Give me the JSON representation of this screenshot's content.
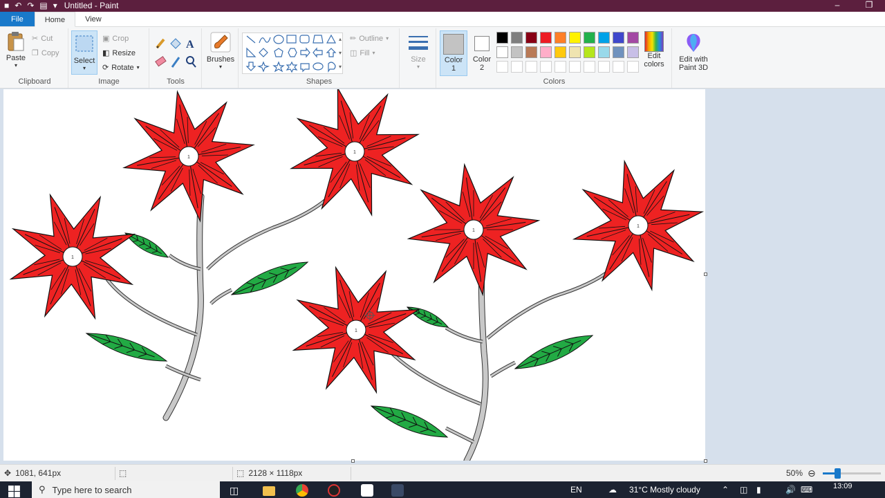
{
  "window": {
    "title": "Untitled - Paint",
    "minimize_glyph": "–",
    "restore_glyph": "❐"
  },
  "quick_access": {
    "undo_icon": "undo-icon",
    "redo_icon": "redo-icon",
    "save_icon": "save-icon"
  },
  "tabs": [
    {
      "label": "File"
    },
    {
      "label": "Home"
    },
    {
      "label": "View"
    }
  ],
  "ribbon": {
    "clipboard": {
      "group_label": "Clipboard",
      "paste": "Paste",
      "cut": "Cut",
      "copy": "Copy"
    },
    "image": {
      "group_label": "Image",
      "select": "Select",
      "crop": "Crop",
      "resize": "Resize",
      "rotate": "Rotate"
    },
    "tools": {
      "group_label": "Tools",
      "brushes": "Brushes"
    },
    "shapes": {
      "group_label": "Shapes",
      "outline": "Outline",
      "fill": "Fill"
    },
    "size": {
      "label": "Size"
    },
    "colors": {
      "group_label": "Colors",
      "color1": "Color 1",
      "color1_a": "Color",
      "color1_b": "1",
      "color2_a": "Color",
      "color2_b": "2",
      "edit_a": "Edit",
      "edit_b": "colors",
      "paint3d_a": "Edit with",
      "paint3d_b": "Paint 3D",
      "color1_value": "#c3c3c3",
      "color2_value": "#ffffff",
      "palette_row1": [
        "#000000",
        "#7f7f7f",
        "#880015",
        "#ed1c24",
        "#ff7f27",
        "#fff200",
        "#22b14c",
        "#00a2e8",
        "#3f48cc",
        "#a349a4"
      ],
      "palette_row2": [
        "#ffffff",
        "#c3c3c3",
        "#b97a57",
        "#ffaec9",
        "#ffc90e",
        "#efe4b0",
        "#b5e61d",
        "#99d9ea",
        "#7092be",
        "#c8bfe7"
      ]
    }
  },
  "drawing": {
    "petal_color": "#ee2222",
    "leaf_color": "#22aa44",
    "stem_color": "#c8c8c8",
    "center_glyph": "1"
  },
  "status": {
    "cursor_pos": "1081, 641px",
    "canvas_size": "2128 × 1118px",
    "zoom": "50%",
    "zoom_fraction": 0.25
  },
  "taskbar": {
    "search_placeholder": "Type here to search",
    "lang": "EN",
    "weather": "31°C  Mostly cloudy",
    "time": "13:09"
  }
}
